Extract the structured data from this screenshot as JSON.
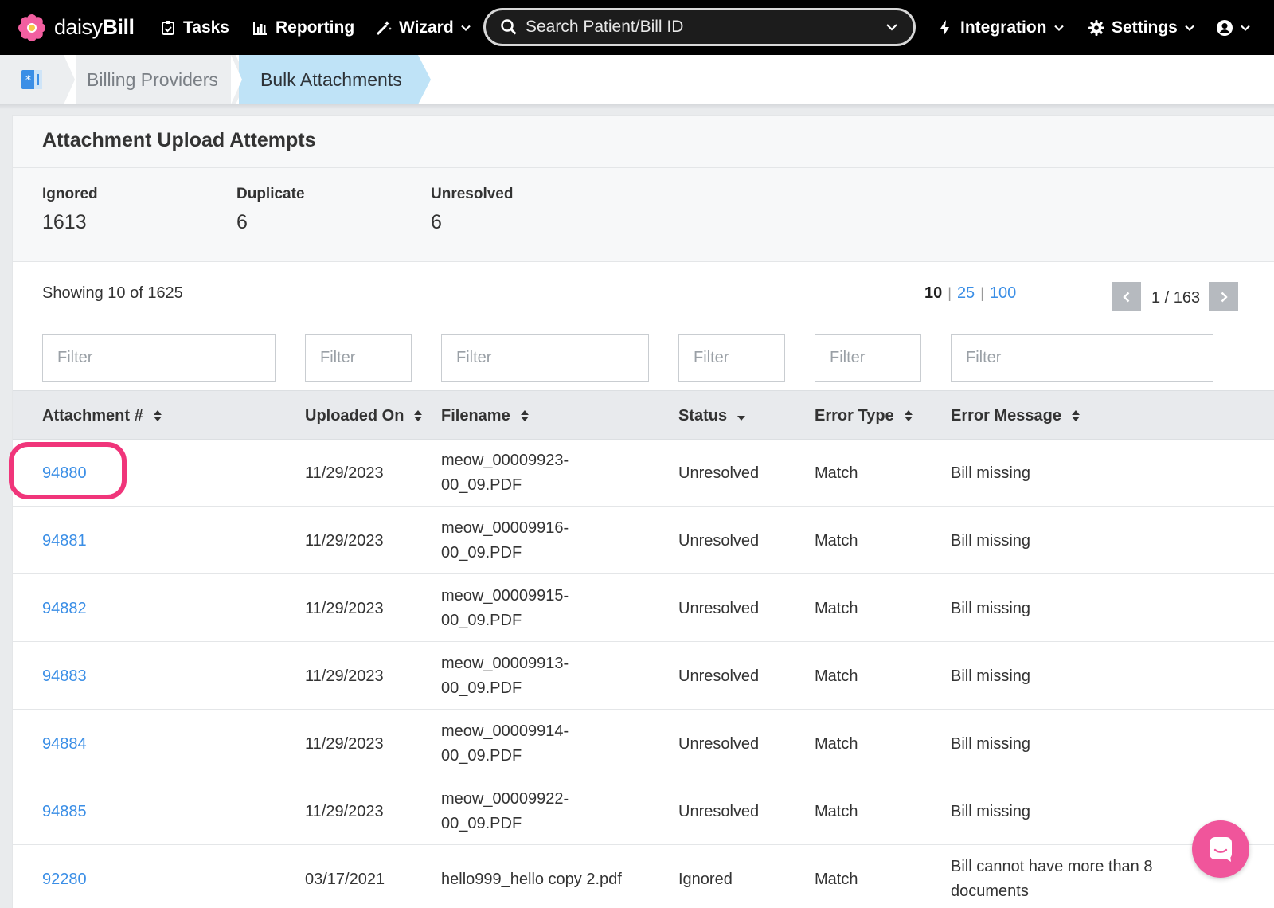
{
  "nav": {
    "brand_light": "daisy",
    "brand_bold": "Bill",
    "tasks": "Tasks",
    "reporting": "Reporting",
    "wizard": "Wizard",
    "search_placeholder": "Search Patient/Bill ID",
    "integration": "Integration",
    "settings": "Settings"
  },
  "breadcrumb": {
    "items": [
      "Billing Providers",
      "Bulk Attachments"
    ]
  },
  "panel": {
    "title": "Attachment Upload Attempts",
    "stats": [
      {
        "label": "Ignored",
        "value": "1613"
      },
      {
        "label": "Duplicate",
        "value": "6"
      },
      {
        "label": "Unresolved",
        "value": "6"
      }
    ],
    "showing": "Showing 10 of 1625",
    "page_sizes": {
      "current": "10",
      "options": [
        "25",
        "100"
      ]
    },
    "pager": "1 / 163",
    "filter_placeholder": "Filter"
  },
  "table": {
    "columns": [
      "Attachment #",
      "Uploaded On",
      "Filename",
      "Status",
      "Error Type",
      "Error Message"
    ],
    "rows": [
      {
        "id": "94880",
        "uploaded": "11/29/2023",
        "file1": "meow_00009923-",
        "file2": "00_09.PDF",
        "status": "Unresolved",
        "error_type": "Match",
        "msg1": "Bill missing",
        "msg2": ""
      },
      {
        "id": "94881",
        "uploaded": "11/29/2023",
        "file1": "meow_00009916-",
        "file2": "00_09.PDF",
        "status": "Unresolved",
        "error_type": "Match",
        "msg1": "Bill missing",
        "msg2": ""
      },
      {
        "id": "94882",
        "uploaded": "11/29/2023",
        "file1": "meow_00009915-",
        "file2": "00_09.PDF",
        "status": "Unresolved",
        "error_type": "Match",
        "msg1": "Bill missing",
        "msg2": ""
      },
      {
        "id": "94883",
        "uploaded": "11/29/2023",
        "file1": "meow_00009913-",
        "file2": "00_09.PDF",
        "status": "Unresolved",
        "error_type": "Match",
        "msg1": "Bill missing",
        "msg2": ""
      },
      {
        "id": "94884",
        "uploaded": "11/29/2023",
        "file1": "meow_00009914-",
        "file2": "00_09.PDF",
        "status": "Unresolved",
        "error_type": "Match",
        "msg1": "Bill missing",
        "msg2": ""
      },
      {
        "id": "94885",
        "uploaded": "11/29/2023",
        "file1": "meow_00009922-",
        "file2": "00_09.PDF",
        "status": "Unresolved",
        "error_type": "Match",
        "msg1": "Bill missing",
        "msg2": ""
      },
      {
        "id": "92280",
        "uploaded": "03/17/2021",
        "file1": "hello999_hello copy 2.pdf",
        "file2": "",
        "status": "Ignored",
        "error_type": "Match",
        "msg1": "Bill cannot have more than 8",
        "msg2": "documents"
      }
    ]
  },
  "colors": {
    "link": "#3a8ee6",
    "highlight": "#f0357a",
    "chat": "#f0559b",
    "breadcrumb_active": "#bfe3f7"
  },
  "icons": [
    "daisy-logo-icon",
    "tasks-icon",
    "reporting-icon",
    "wizard-icon",
    "search-icon",
    "integration-icon",
    "settings-icon",
    "user-icon",
    "sort-icon",
    "chat-icon"
  ]
}
